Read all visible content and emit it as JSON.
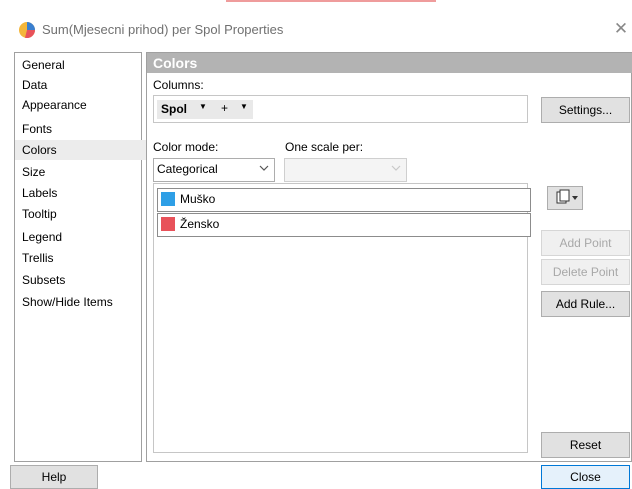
{
  "window": {
    "title": "Sum(Mjesecni prihod) per Spol Properties",
    "close_glyph": "✕",
    "accent_color": "#0078d7"
  },
  "nav": {
    "items": [
      {
        "label": "General"
      },
      {
        "label": "Data"
      },
      {
        "label": "Appearance"
      },
      {
        "label": "Fonts"
      },
      {
        "label": "Colors",
        "selected": true
      },
      {
        "label": "Size"
      },
      {
        "label": "Labels"
      },
      {
        "label": "Tooltip"
      },
      {
        "label": "Legend"
      },
      {
        "label": "Trellis"
      },
      {
        "label": "Subsets"
      },
      {
        "label": "Show/Hide Items"
      }
    ]
  },
  "panel": {
    "title": "Colors",
    "columns_label": "Columns:",
    "column": {
      "name": "Spol",
      "dropdown_glyph": "▼",
      "add_glyph": "+",
      "add_dropdown_glyph": "▼"
    },
    "settings_button": "Settings...",
    "color_mode_label": "Color mode:",
    "color_mode_value": "Categorical",
    "one_scale_label": "One scale per:",
    "one_scale_value": "",
    "categories": [
      {
        "label": "Muško",
        "color": "#2e9fe6"
      },
      {
        "label": "Žensko",
        "color": "#e8525a"
      }
    ],
    "copy_button_icon": "copy-dropdown-icon",
    "add_point_button": "Add Point",
    "delete_point_button": "Delete Point",
    "add_rule_button": "Add Rule...",
    "reset_button": "Reset"
  },
  "footer": {
    "help_button": "Help",
    "close_button": "Close"
  }
}
